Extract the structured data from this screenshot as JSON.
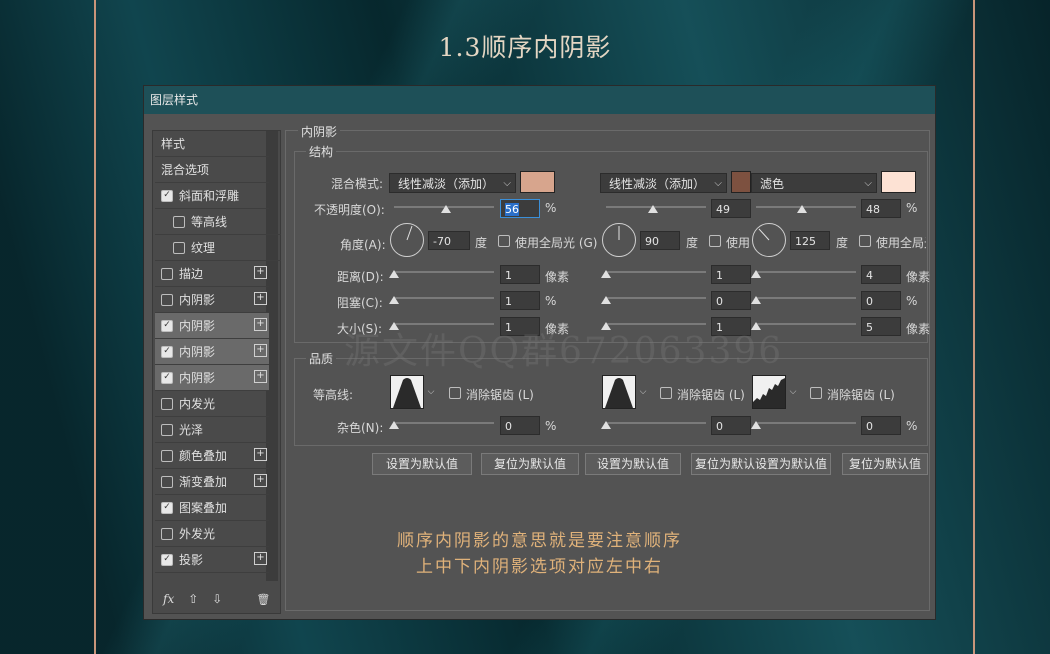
{
  "page_title": "1.3顺序内阴影",
  "dialog": {
    "title": "图层样式",
    "watermark": "源文件QQ群672063396"
  },
  "sidebar": {
    "items": [
      {
        "label": "样式",
        "checkbox": false,
        "plus": false,
        "indent": false
      },
      {
        "label": "混合选项",
        "checkbox": false,
        "plus": false,
        "indent": false
      },
      {
        "label": "斜面和浮雕",
        "checkbox": true,
        "checked": true,
        "plus": false,
        "indent": false
      },
      {
        "label": "等高线",
        "checkbox": true,
        "checked": false,
        "plus": false,
        "indent": true
      },
      {
        "label": "纹理",
        "checkbox": true,
        "checked": false,
        "plus": false,
        "indent": true
      },
      {
        "label": "描边",
        "checkbox": true,
        "checked": false,
        "plus": true,
        "indent": false
      },
      {
        "label": "内阴影",
        "checkbox": true,
        "checked": false,
        "plus": true,
        "indent": false
      },
      {
        "label": "内阴影",
        "checkbox": true,
        "checked": true,
        "plus": true,
        "indent": false,
        "active": true
      },
      {
        "label": "内阴影",
        "checkbox": true,
        "checked": true,
        "plus": true,
        "indent": false,
        "active": true
      },
      {
        "label": "内阴影",
        "checkbox": true,
        "checked": true,
        "plus": true,
        "indent": false,
        "active": true
      },
      {
        "label": "内发光",
        "checkbox": true,
        "checked": false,
        "plus": false,
        "indent": false
      },
      {
        "label": "光泽",
        "checkbox": true,
        "checked": false,
        "plus": false,
        "indent": false
      },
      {
        "label": "颜色叠加",
        "checkbox": true,
        "checked": false,
        "plus": true,
        "indent": false
      },
      {
        "label": "渐变叠加",
        "checkbox": true,
        "checked": false,
        "plus": true,
        "indent": false
      },
      {
        "label": "图案叠加",
        "checkbox": true,
        "checked": true,
        "plus": false,
        "indent": false
      },
      {
        "label": "外发光",
        "checkbox": true,
        "checked": false,
        "plus": false,
        "indent": false
      },
      {
        "label": "投影",
        "checkbox": true,
        "checked": true,
        "plus": true,
        "indent": false
      }
    ],
    "footer": {
      "fx": "fx",
      "up": "⇧",
      "down": "⇩",
      "trash": "🗑"
    }
  },
  "panel": {
    "section_title": "内阴影",
    "structure_title": "结构",
    "quality_title": "品质",
    "labels": {
      "blend_mode": "混合模式:",
      "opacity": "不透明度(O):",
      "angle": "角度(A):",
      "distance": "距离(D):",
      "choke": "阻塞(C):",
      "size": "大小(S):",
      "contour": "等高线:",
      "noise": "杂色(N):"
    },
    "units": {
      "percent": "%",
      "degree": "度",
      "pixel": "像素"
    },
    "global_light": [
      "使用全局光 (G)",
      "使用",
      "使用全局光"
    ],
    "anti_alias": "消除锯齿 (L)",
    "columns": [
      {
        "blend": "线性减淡（添加）",
        "color": "#d7a58d",
        "opacity": "56",
        "angle": "-70",
        "distance": "1",
        "choke": "1",
        "size": "1",
        "noise": "0",
        "opacity_level": 0.56
      },
      {
        "blend": "线性减淡（添加）",
        "color": "#7d5140",
        "opacity": "49",
        "angle": "90",
        "distance": "1",
        "choke": "0",
        "size": "1",
        "noise": "0",
        "opacity_level": 0.49
      },
      {
        "blend": "滤色",
        "color": "#fde2d4",
        "opacity": "48",
        "angle": "125",
        "distance": "4",
        "choke": "0",
        "size": "5",
        "noise": "0",
        "opacity_level": 0.48
      }
    ],
    "buttons": [
      "设置为默认值",
      "复位为默认值",
      "设置为默认值",
      "复位为默认设置为默认值",
      "复位为默认值"
    ]
  },
  "notes": [
    "顺序内阴影的意思就是要注意顺序",
    "上中下内阴影选项对应左中右"
  ]
}
